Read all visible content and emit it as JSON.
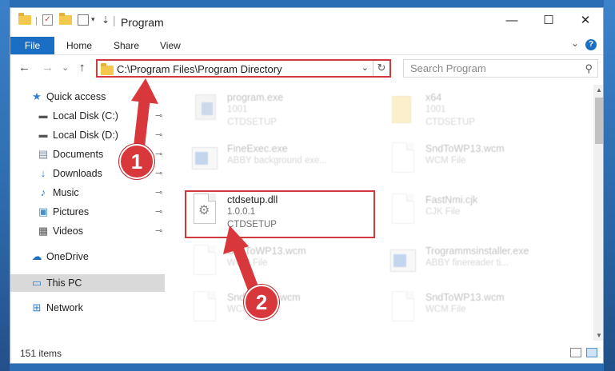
{
  "window": {
    "title": "Program",
    "min_glyph": "—",
    "max_glyph": "☐",
    "close_glyph": "✕"
  },
  "ribbon": {
    "tabs": [
      "File",
      "Home",
      "Share",
      "View"
    ],
    "expand_glyph": "⌄",
    "help_glyph": "?"
  },
  "nav": {
    "back_glyph": "←",
    "forward_glyph": "→",
    "recent_glyph": "⌄",
    "up_glyph": "↑",
    "address": "C:\\Program Files\\Program Directory",
    "dropdown_glyph": "⌄",
    "refresh_glyph": "↻",
    "search_placeholder": "Search Program",
    "search_glyph": "⚲"
  },
  "sidebar": {
    "items": [
      {
        "label": "Quick access",
        "icon": "star-icon",
        "pinned": false
      },
      {
        "label": "Local Disk (C:)",
        "icon": "drive-icon",
        "pinned": true
      },
      {
        "label": "Local Disk (D:)",
        "icon": "drive-icon",
        "pinned": true
      },
      {
        "label": "Documents",
        "icon": "documents-icon",
        "pinned": true
      },
      {
        "label": "Downloads",
        "icon": "download-icon",
        "pinned": true
      },
      {
        "label": "Music",
        "icon": "music-icon",
        "pinned": true
      },
      {
        "label": "Pictures",
        "icon": "pictures-icon",
        "pinned": true
      },
      {
        "label": "Videos",
        "icon": "videos-icon",
        "pinned": true
      },
      {
        "label": "OneDrive",
        "icon": "cloud-icon",
        "pinned": false
      },
      {
        "label": "This PC",
        "icon": "computer-icon",
        "pinned": false,
        "selected": true
      },
      {
        "label": "Network",
        "icon": "network-icon",
        "pinned": false
      }
    ],
    "pin_glyph": "📌"
  },
  "files": {
    "left": [
      {
        "name": "program.exe",
        "line2": "1001",
        "line3": "CTDSETUP"
      },
      {
        "name": "FineExec.exe",
        "line2": "ABBY background exe...",
        "line3": ""
      },
      {
        "name": "ctdsetup.dll",
        "line2": "1.0.0.1",
        "line3": "CTDSETUP"
      },
      {
        "name": "SndToWP13.wcm",
        "line2": "WCM File",
        "line3": ""
      },
      {
        "name": "SndToWP2.wcm",
        "line2": "WCM File",
        "line3": ""
      }
    ],
    "right": [
      {
        "name": "x64",
        "line2": "1001",
        "line3": "CTDSETUP"
      },
      {
        "name": "SndToWP13.wcm",
        "line2": "WCM File",
        "line3": ""
      },
      {
        "name": "FastNmi.cjk",
        "line2": "CJK File",
        "line3": ""
      },
      {
        "name": "Trogrammsinstaller.exe",
        "line2": "ABBY finereader ti...",
        "line3": ""
      },
      {
        "name": "SndToWP13.wcm",
        "line2": "WCM File",
        "line3": ""
      }
    ]
  },
  "status": {
    "item_count": "151 items"
  },
  "steps": {
    "step1": "1",
    "step2": "2"
  },
  "colors": {
    "accent": "#1a6fc4",
    "highlight": "#d0393e",
    "badge": "#d8373c"
  }
}
